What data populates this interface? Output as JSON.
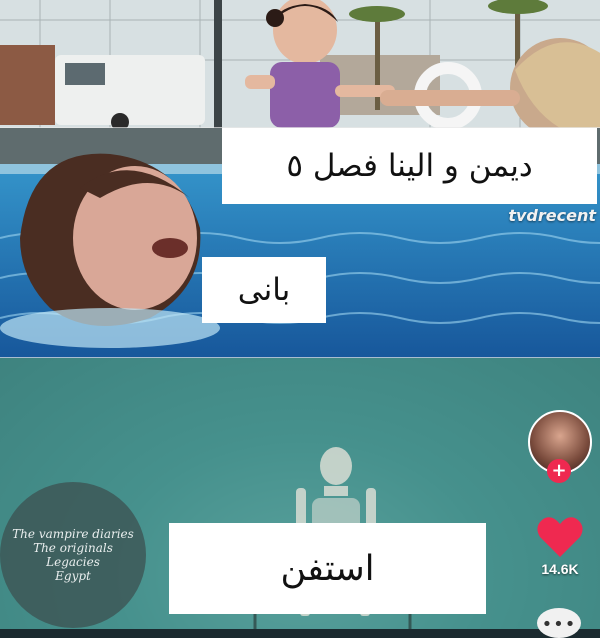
{
  "captions": {
    "top": "ديمن و الينا فصل ٥",
    "middle": "بانى",
    "bottom": "استفن"
  },
  "watermark": "tvdrecent",
  "logo_text": [
    "The vampire diaries",
    "The originals",
    "Legacies",
    "Egypt"
  ],
  "sidebar": {
    "likes_count": "14.6K",
    "follow_icon": "plus-icon",
    "like_icon": "heart-icon",
    "more_icon": "ellipsis-icon"
  },
  "colors": {
    "like": "#ef2950",
    "pool": "#1e6fb0",
    "deep_water": "#3e8a86"
  }
}
